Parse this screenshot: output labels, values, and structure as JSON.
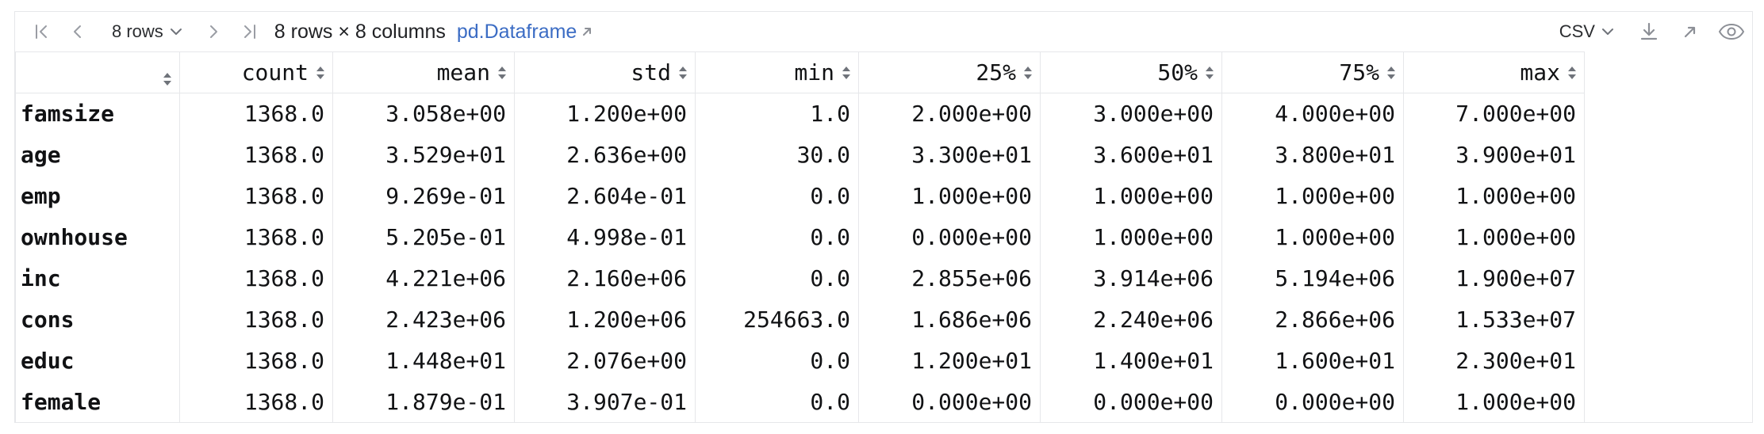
{
  "toolbar": {
    "rows_label": "8 rows",
    "summary": "8 rows × 8 columns",
    "link": "pd.Dataframe",
    "format_label": "CSV"
  },
  "table": {
    "columns": [
      "",
      "count",
      "mean",
      "std",
      "min",
      "25%",
      "50%",
      "75%",
      "max"
    ],
    "rows": [
      {
        "label": "famsize",
        "cells": [
          "1368.0",
          "3.058e+00",
          "1.200e+00",
          "1.0",
          "2.000e+00",
          "3.000e+00",
          "4.000e+00",
          "7.000e+00"
        ]
      },
      {
        "label": "age",
        "cells": [
          "1368.0",
          "3.529e+01",
          "2.636e+00",
          "30.0",
          "3.300e+01",
          "3.600e+01",
          "3.800e+01",
          "3.900e+01"
        ]
      },
      {
        "label": "emp",
        "cells": [
          "1368.0",
          "9.269e-01",
          "2.604e-01",
          "0.0",
          "1.000e+00",
          "1.000e+00",
          "1.000e+00",
          "1.000e+00"
        ]
      },
      {
        "label": "ownhouse",
        "cells": [
          "1368.0",
          "5.205e-01",
          "4.998e-01",
          "0.0",
          "0.000e+00",
          "1.000e+00",
          "1.000e+00",
          "1.000e+00"
        ]
      },
      {
        "label": "inc",
        "cells": [
          "1368.0",
          "4.221e+06",
          "2.160e+06",
          "0.0",
          "2.855e+06",
          "3.914e+06",
          "5.194e+06",
          "1.900e+07"
        ]
      },
      {
        "label": "cons",
        "cells": [
          "1368.0",
          "2.423e+06",
          "1.200e+06",
          "254663.0",
          "1.686e+06",
          "2.240e+06",
          "2.866e+06",
          "1.533e+07"
        ]
      },
      {
        "label": "educ",
        "cells": [
          "1368.0",
          "1.448e+01",
          "2.076e+00",
          "0.0",
          "1.200e+01",
          "1.400e+01",
          "1.600e+01",
          "2.300e+01"
        ]
      },
      {
        "label": "female",
        "cells": [
          "1368.0",
          "1.879e-01",
          "3.907e-01",
          "0.0",
          "0.000e+00",
          "0.000e+00",
          "0.000e+00",
          "1.000e+00"
        ]
      }
    ]
  }
}
